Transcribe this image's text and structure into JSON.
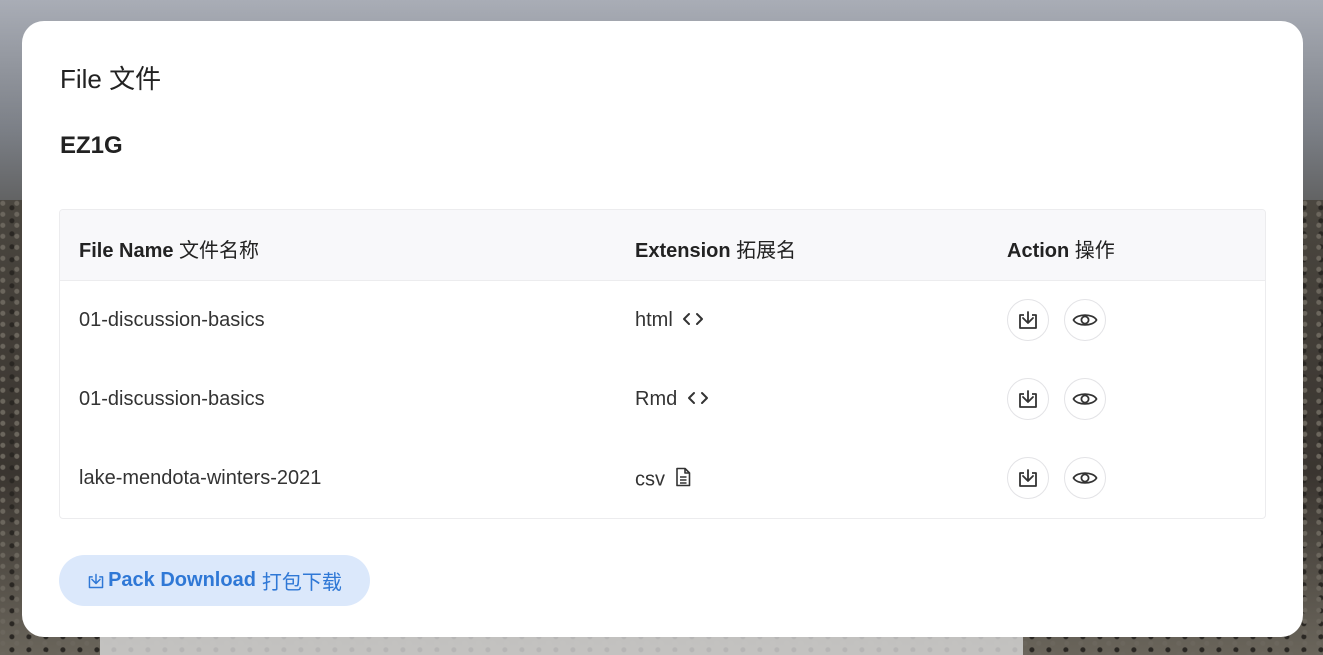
{
  "page": {
    "title": "File 文件",
    "subtitle": "EZ1G"
  },
  "table": {
    "headers": {
      "name": {
        "en": "File Name",
        "cn": "文件名称"
      },
      "ext": {
        "en": "Extension",
        "cn": "拓展名"
      },
      "action": {
        "en": "Action",
        "cn": "操作"
      }
    },
    "rows": [
      {
        "name": "01-discussion-basics",
        "ext": "html",
        "ext_icon": "code-icon"
      },
      {
        "name": "01-discussion-basics",
        "ext": "Rmd",
        "ext_icon": "code-icon"
      },
      {
        "name": "lake-mendota-winters-2021",
        "ext": "csv",
        "ext_icon": "file-text-icon"
      }
    ]
  },
  "pack_download": {
    "en": "Pack Download",
    "cn": "打包下载",
    "icon": "download-icon"
  },
  "colors": {
    "accent": "#2f78d6",
    "accent_bg": "#dbe8fb",
    "header_bg": "#f8f8fa"
  }
}
